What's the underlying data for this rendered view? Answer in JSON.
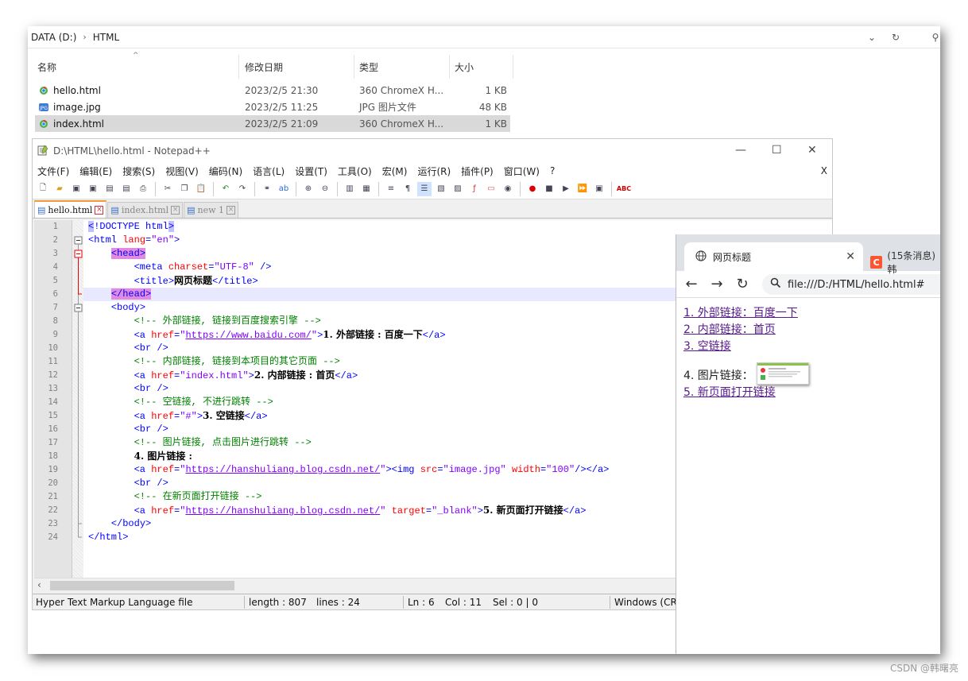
{
  "explorer": {
    "path": [
      "DATA (D:)",
      "HTML"
    ],
    "columns": [
      "名称",
      "修改日期",
      "类型",
      "大小"
    ],
    "files": [
      {
        "name": "hello.html",
        "date": "2023/2/5 21:30",
        "type": "360 ChromeX H...",
        "size": "1 KB",
        "icon": "chrome-html-icon"
      },
      {
        "name": "image.jpg",
        "date": "2023/2/5 11:25",
        "type": "JPG 图片文件",
        "size": "48 KB",
        "icon": "jpg-file-icon"
      },
      {
        "name": "index.html",
        "date": "2023/2/5 21:09",
        "type": "360 ChromeX H...",
        "size": "1 KB",
        "icon": "chrome-html-icon",
        "selected": true
      }
    ]
  },
  "notepad": {
    "title": "D:\\HTML\\hello.html - Notepad++",
    "menu": [
      "文件(F)",
      "编辑(E)",
      "搜索(S)",
      "视图(V)",
      "编码(N)",
      "语言(L)",
      "设置(T)",
      "工具(O)",
      "宏(M)",
      "运行(R)",
      "插件(P)",
      "窗口(W)",
      "?"
    ],
    "close_x": "X",
    "tabs": [
      {
        "label": "hello.html",
        "active": true
      },
      {
        "label": "index.html",
        "active": false
      },
      {
        "label": "new 1",
        "active": false
      }
    ],
    "line_numbers": [
      "1",
      "2",
      "3",
      "4",
      "5",
      "6",
      "7",
      "8",
      "9",
      "10",
      "11",
      "12",
      "13",
      "14",
      "15",
      "16",
      "17",
      "18",
      "19",
      "20",
      "21",
      "22",
      "23",
      "24"
    ],
    "status": {
      "filetype": "Hyper Text Markup Language file",
      "length": "length : 807",
      "lines": "lines : 24",
      "ln": "Ln : 6",
      "col": "Col : 11",
      "sel": "Sel : 0 | 0",
      "eol": "Windows (CR"
    }
  },
  "browser": {
    "tab_title": "网页标题",
    "tab2_title": "(15条消息) 韩",
    "url": "file:///D:/HTML/hello.html#",
    "links": {
      "l1": "1. 外部链接：百度一下",
      "l2": "2. 内部链接：首页",
      "l3": "3. 空链接",
      "l4": "4. 图片链接：",
      "l5": "5. 新页面打开链接"
    }
  },
  "watermark": "CSDN @韩曙亮"
}
